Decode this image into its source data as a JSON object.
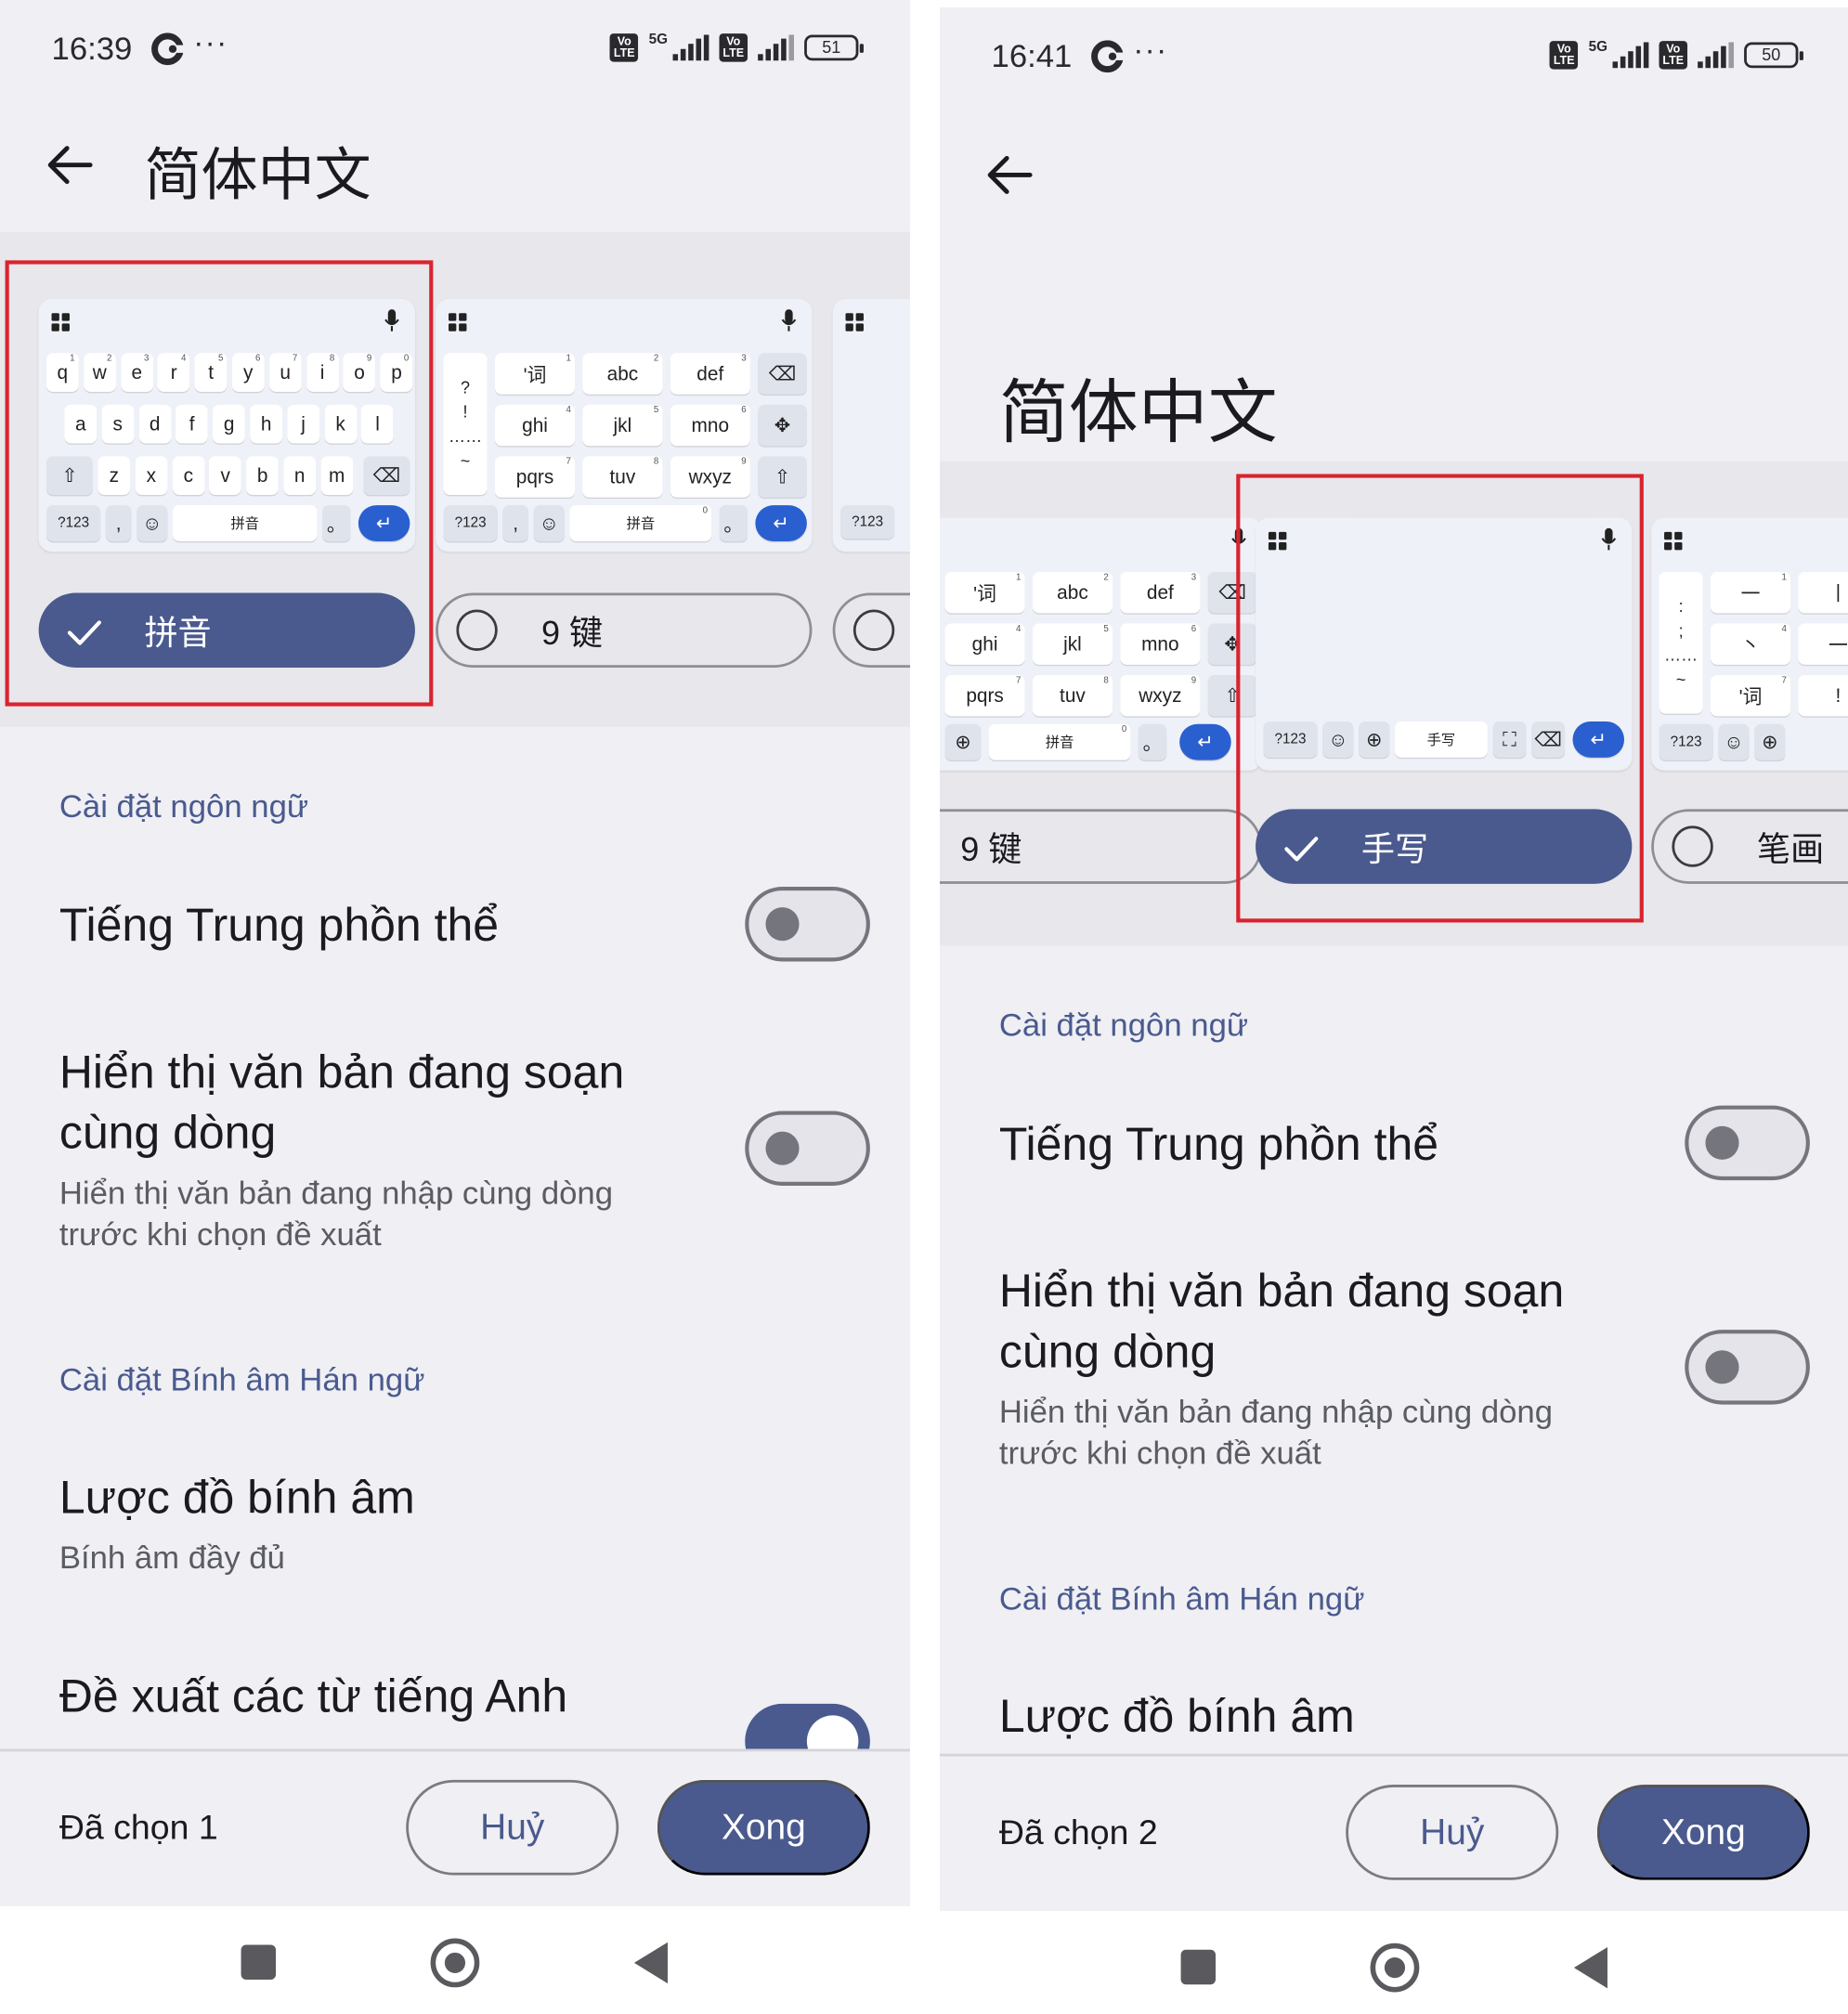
{
  "left": {
    "status": {
      "time": "16:39",
      "battery": "51",
      "network": "5G",
      "volte": "Vo LTE"
    },
    "title": "简体中文",
    "layouts": [
      {
        "label": "拼音",
        "selected": true
      },
      {
        "label": "9 键",
        "selected": false
      }
    ],
    "keyboard_qwerty": {
      "row1": [
        "q",
        "w",
        "e",
        "r",
        "t",
        "y",
        "u",
        "i",
        "o",
        "p"
      ],
      "row1_hints": [
        "1",
        "2",
        "3",
        "4",
        "5",
        "6",
        "7",
        "8",
        "9",
        "0"
      ],
      "row2": [
        "a",
        "s",
        "d",
        "f",
        "g",
        "h",
        "j",
        "k",
        "l"
      ],
      "row3": [
        "z",
        "x",
        "c",
        "v",
        "b",
        "n",
        "m"
      ],
      "sym": "?123",
      "comma": ",",
      "space": "拼音",
      "period": "。"
    },
    "keyboard_9key": {
      "side": [
        "?",
        "!",
        "……",
        "~"
      ],
      "rows": [
        [
          "'词",
          "abc",
          "def"
        ],
        [
          "ghi",
          "jkl",
          "mno"
        ],
        [
          "pqrs",
          "tuv",
          "wxyz"
        ]
      ],
      "hints": [
        [
          "1",
          "2",
          "3"
        ],
        [
          "4",
          "5",
          "6"
        ],
        [
          "7",
          "8",
          "9"
        ]
      ],
      "sym": "?123",
      "comma": ",",
      "space": "拼音",
      "zero": "0",
      "period": "。"
    },
    "peek_sym": "?123",
    "sections": {
      "language": "Cài đặt ngôn ngữ",
      "pinyin": "Cài đặt Bính âm Hán ngữ"
    },
    "rows": {
      "traditional": {
        "title": "Tiếng Trung phồn thể",
        "on": false
      },
      "inline": {
        "title": "Hiển thị văn bản đang soạn cùng dòng",
        "sub": "Hiển thị văn bản đang nhập cùng dòng trước khi chọn đề xuất",
        "on": false
      },
      "scheme": {
        "title": "Lược đồ bính âm",
        "sub": "Bính âm đầy đủ"
      },
      "english": {
        "title": "Đề xuất các từ tiếng Anh",
        "on": true
      }
    },
    "bottom": {
      "count": "Đã chọn 1",
      "cancel": "Huỷ",
      "done": "Xong"
    }
  },
  "right": {
    "status": {
      "time": "16:41",
      "battery": "50",
      "network": "5G",
      "volte": "Vo LTE"
    },
    "title": "简体中文",
    "layouts": [
      {
        "label": "9 键",
        "selected": false
      },
      {
        "label": "手写",
        "selected": true
      },
      {
        "label": "笔画",
        "selected": false
      }
    ],
    "keyboard_9key": {
      "rows": [
        [
          "'词",
          "abc",
          "def"
        ],
        [
          "ghi",
          "jkl",
          "mno"
        ],
        [
          "pqrs",
          "tuv",
          "wxyz"
        ]
      ],
      "hints": [
        [
          "1",
          "2",
          "3"
        ],
        [
          "4",
          "5",
          "6"
        ],
        [
          "7",
          "8",
          "9"
        ]
      ],
      "space": "拼音",
      "zero": "0",
      "period": "。"
    },
    "keyboard_hand": {
      "sym": "?123",
      "space": "手写"
    },
    "keyboard_stroke": {
      "side": [
        ":",
        ";",
        "……",
        "~"
      ],
      "keys": [
        "一",
        "丨",
        "丶",
        "一",
        "'词",
        "!"
      ],
      "hints": [
        "1",
        "2",
        "4",
        "7"
      ],
      "sym": "?123"
    },
    "sections": {
      "language": "Cài đặt ngôn ngữ",
      "pinyin": "Cài đặt Bính âm Hán ngữ"
    },
    "rows": {
      "traditional": {
        "title": "Tiếng Trung phồn thể",
        "on": false
      },
      "inline": {
        "title": "Hiển thị văn bản đang soạn cùng dòng",
        "sub": "Hiển thị văn bản đang nhập cùng dòng trước khi chọn đề xuất",
        "on": false
      },
      "scheme": {
        "title": "Lược đồ bính âm"
      }
    },
    "bottom": {
      "count": "Đã chọn 2",
      "cancel": "Huỷ",
      "done": "Xong"
    }
  },
  "colors": {
    "accent": "#4a5a8e",
    "highlight": "#d9232e",
    "enter": "#2a5fd0",
    "background": "#efeff4"
  }
}
